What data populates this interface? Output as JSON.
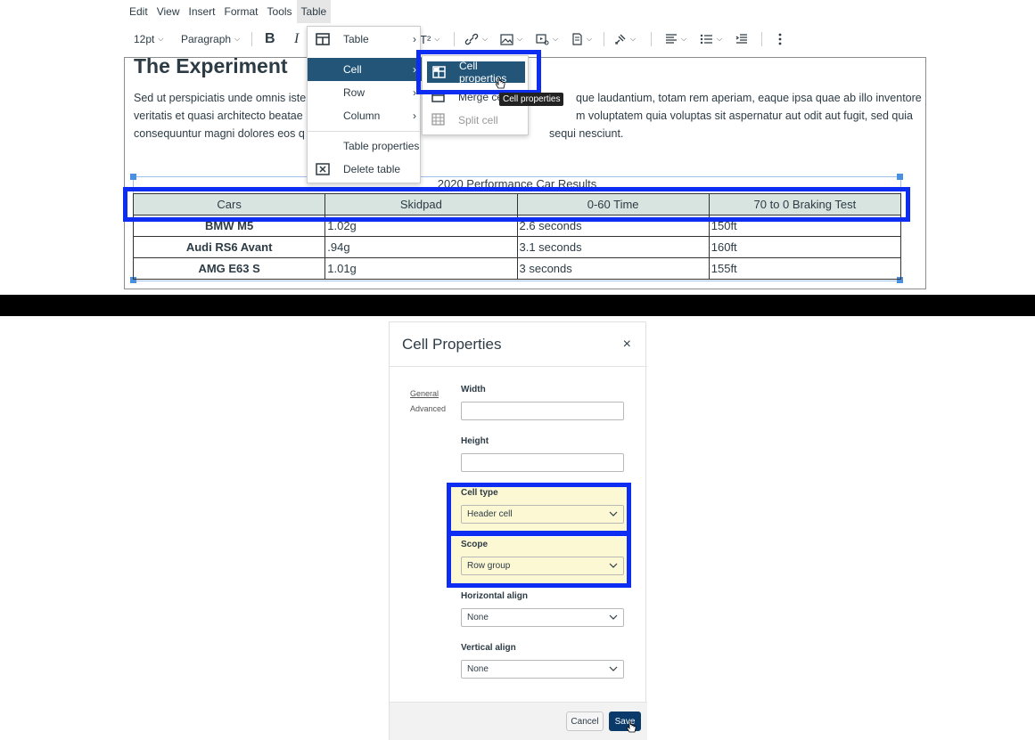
{
  "menubar": {
    "items": [
      "Edit",
      "View",
      "Insert",
      "Format",
      "Tools",
      "Table"
    ]
  },
  "toolbar": {
    "font_size": "12pt",
    "block_format": "Paragraph",
    "bold": "B",
    "italic": "I",
    "superscript": "T²"
  },
  "editor": {
    "heading": "The Experiment",
    "paragraph_lines": [
      "Sed ut perspiciatis unde omnis iste",
      "veritatis et quasi architecto beatae",
      "consequuntur magni dolores eos q"
    ],
    "paragraph_right_lines": [
      "que laudantium, totam rem aperiam, eaque ipsa quae ab illo inventore",
      "m voluptatem quia voluptas sit aspernatur aut odit aut fugit, sed quia",
      "sequi nesciunt."
    ],
    "table": {
      "caption": "2020 Performance Car Results",
      "headers": [
        "Cars",
        "Skidpad",
        "0-60 Time",
        "70 to 0 Braking Test"
      ],
      "rows": [
        [
          "BMW M5",
          "1.02g",
          "2.6 seconds",
          "150ft"
        ],
        [
          "Audi RS6 Avant",
          ".94g",
          "3.1 seconds",
          "160ft"
        ],
        [
          "AMG E63 S",
          "1.01g",
          "3 seconds",
          "155ft"
        ]
      ]
    }
  },
  "table_menu": {
    "items": [
      "Table",
      "Cell",
      "Row",
      "Column",
      "Table properties",
      "Delete table"
    ]
  },
  "cell_submenu": {
    "items": [
      "Cell properties",
      "Merge cells",
      "Split cell"
    ],
    "tooltip": "Cell properties"
  },
  "dialog": {
    "title": "Cell Properties",
    "close": "×",
    "tabs": [
      "General",
      "Advanced"
    ],
    "width_label": "Width",
    "height_label": "Height",
    "cell_type_label": "Cell type",
    "cell_type_value": "Header cell",
    "scope_label": "Scope",
    "scope_value": "Row group",
    "h_align_label": "Horizontal align",
    "h_align_value": "None",
    "v_align_label": "Vertical align",
    "v_align_value": "None",
    "cancel": "Cancel",
    "save": "Save"
  },
  "colors": {
    "highlight": "#0d2ef2",
    "menu_hover": "#225577",
    "header_fill": "#d7e4e0",
    "field_highlight": "#fcf8d4",
    "save_button": "#0a3a6a"
  }
}
